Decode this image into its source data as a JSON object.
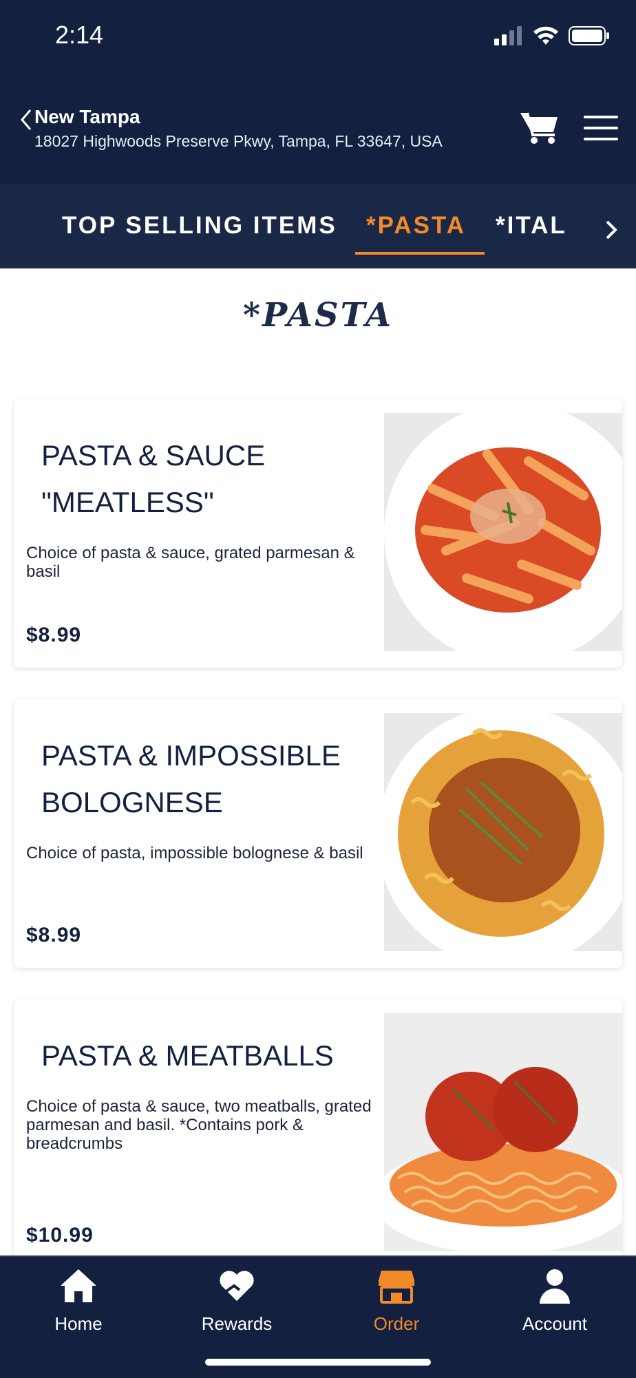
{
  "status": {
    "time": "2:14"
  },
  "header": {
    "store_name": "New Tampa",
    "address": "18027 Highwoods Preserve Pkwy, Tampa, FL 33647, USA"
  },
  "tabs": [
    {
      "label": "TOP SELLING ITEMS",
      "active": false
    },
    {
      "label": "*PASTA",
      "active": true
    },
    {
      "label": "*ITALI",
      "active": false
    }
  ],
  "section_title": "*PASTA",
  "items": [
    {
      "name": "PASTA & SAUCE \"MEATLESS\"",
      "description": "Choice of pasta & sauce, grated parmesan & basil",
      "price": "$8.99"
    },
    {
      "name": "PASTA & IMPOSSIBLE BOLOGNESE",
      "description": "Choice of pasta, impossible bolognese & basil",
      "price": "$8.99"
    },
    {
      "name": "PASTA & MEATBALLS",
      "description": "Choice of pasta & sauce, two meatballs, grated parmesan and basil. *Contains pork & breadcrumbs",
      "price": "$10.99"
    }
  ],
  "bottom_nav": [
    {
      "label": "Home",
      "icon": "home-icon",
      "active": false
    },
    {
      "label": "Rewards",
      "icon": "heart-hand-icon",
      "active": false
    },
    {
      "label": "Order",
      "icon": "store-icon",
      "active": true
    },
    {
      "label": "Account",
      "icon": "person-icon",
      "active": false
    }
  ],
  "colors": {
    "navy": "#13203f",
    "accent": "#f28a2a",
    "tabs_bg": "#1a2847"
  }
}
